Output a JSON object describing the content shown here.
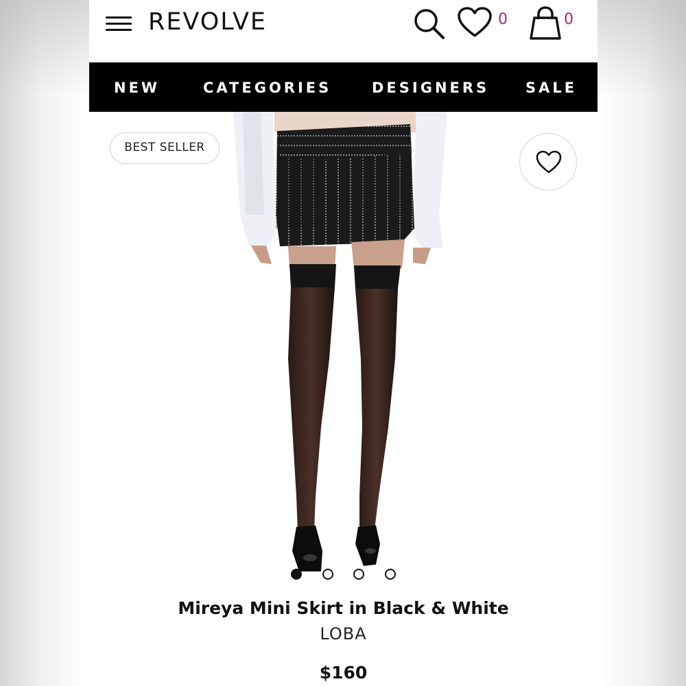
{
  "header": {
    "logo": "REVOLVE",
    "wishlist_count": "0",
    "bag_count": "0",
    "count_color": "#b1246e"
  },
  "nav": {
    "items": [
      "NEW",
      "CATEGORIES",
      "DESIGNERS",
      "SALE"
    ]
  },
  "product": {
    "badge": "BEST SELLER",
    "title": "Mireya Mini Skirt in Black & White",
    "brand": "LOBA",
    "price": "$160",
    "image_count": 4,
    "active_image": 1
  },
  "icons": [
    "menu-icon",
    "search-icon",
    "heart-icon",
    "bag-icon"
  ]
}
